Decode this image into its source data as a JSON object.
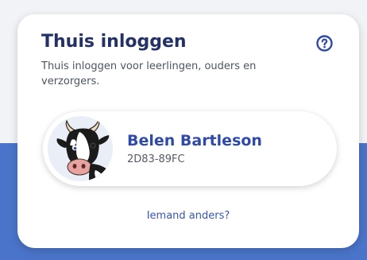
{
  "login": {
    "title": "Thuis inloggen",
    "subtitle": "Thuis inloggen voor leerlingen, ouders en verzorgers.",
    "help_icon": "question-circle-icon"
  },
  "account": {
    "name": "Belen Bartleson",
    "code": "2D83-89FC",
    "avatar": "cow-avatar"
  },
  "other_link": "Iemand anders?",
  "colors": {
    "title": "#233167",
    "name": "#2f4aa8",
    "link": "#3656b2",
    "background_band": "#4a74c9"
  }
}
